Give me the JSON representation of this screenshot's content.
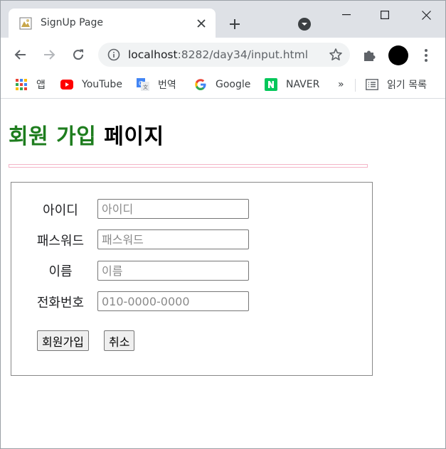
{
  "browser": {
    "tab_title": "SignUp Page",
    "url_host": "localhost",
    "url_path": ":8282/day34/input.html",
    "bookmarks": [
      {
        "label": "앱",
        "icon": "apps-grid-icon"
      },
      {
        "label": "YouTube",
        "icon": "youtube-icon"
      },
      {
        "label": "번역",
        "icon": "translate-icon"
      },
      {
        "label": "Google",
        "icon": "google-icon"
      },
      {
        "label": "NAVER",
        "icon": "naver-icon"
      }
    ],
    "more_bookmarks": "»",
    "reading_list": "읽기 목록"
  },
  "page": {
    "title_green": "회원 가입",
    "title_black": " 페이지",
    "form": {
      "fields": [
        {
          "label": "아이디",
          "placeholder": "아이디"
        },
        {
          "label": "패스워드",
          "placeholder": "패스워드"
        },
        {
          "label": "이름",
          "placeholder": "이름"
        },
        {
          "label": "전화번호",
          "placeholder": "010-0000-0000"
        }
      ],
      "submit_label": "회원가입",
      "cancel_label": "취소"
    }
  },
  "colors": {
    "title_green": "#1e7d1e",
    "divider_pink": "#f4b5c8"
  }
}
